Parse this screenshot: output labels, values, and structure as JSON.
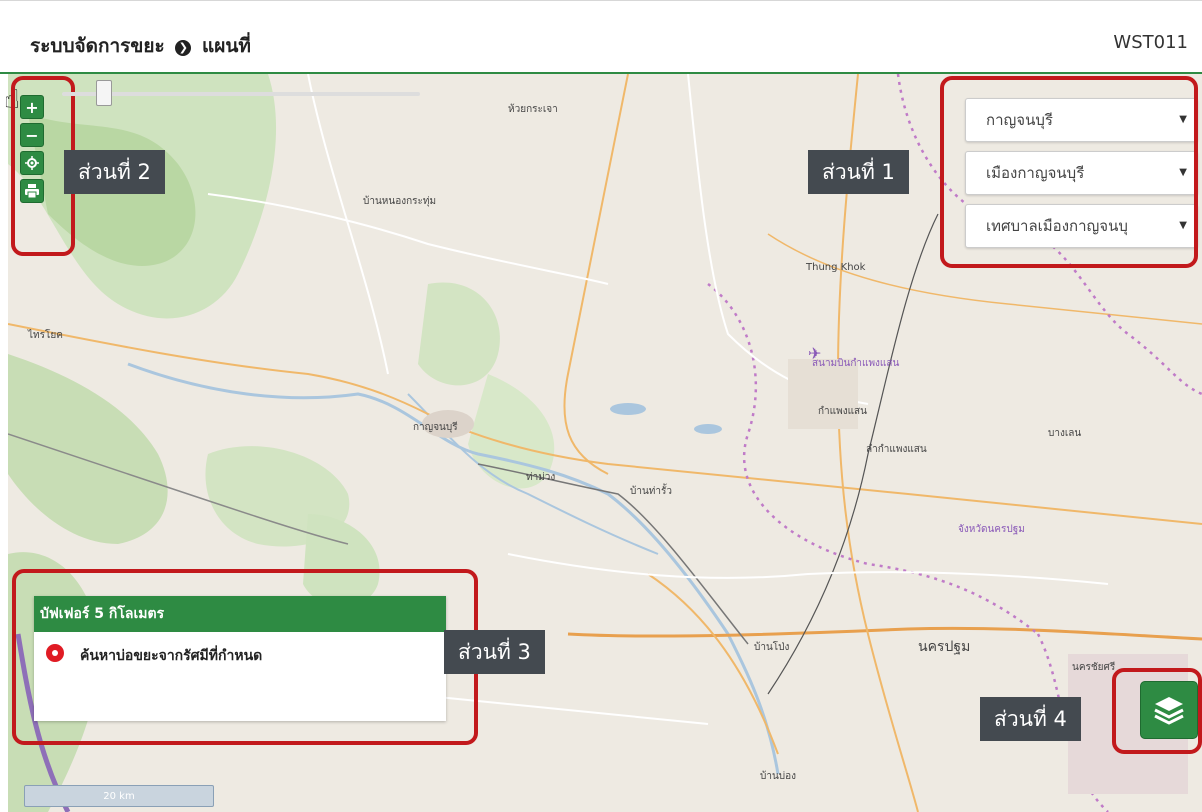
{
  "header": {
    "title": "ระบบจัดการขยะ",
    "arrow": "❯",
    "breadcrumb": "แผนที่",
    "code": "WST011"
  },
  "labels": {
    "part1": "ส่วนที่ 1",
    "part2": "ส่วนที่ 2",
    "part3": "ส่วนที่ 3",
    "part4": "ส่วนที่ 4"
  },
  "tools": {
    "zoom_in": "+",
    "zoom_out": "−",
    "locate": "⌖",
    "print": "⎙"
  },
  "selects": {
    "province": "กาญจนบุรี",
    "district": "เมืองกาญจนบุรี",
    "subdistrict": "เทศบาลเมืองกาญจนบุ"
  },
  "buffer": {
    "title": "บัฟเฟอร์ 5 กิโลเมตร",
    "option": "ค้นหาบ่อขยะจากรัศมีที่กำหนด",
    "slider_value": 0.1
  },
  "map": {
    "places": {
      "p1": "ห้วยกระเจา",
      "p2": "บ้านหนองกระทุ่ม",
      "p3": "ไทรโยค",
      "p4": "Thung Khok",
      "p5": "สนามบินกำแพงแสน",
      "p6": "กำแพงแสน",
      "p7": "ลำกำแพงแสน",
      "p8": "กาญจนบุรี",
      "p9": "ท่าม่วง",
      "p10": "บ้านท่ารั้ว",
      "p11": "จังหวัดนครปฐม",
      "p12": "นครปฐม",
      "p13": "บ้านโป่ง",
      "p14": "บ้านบ่อง",
      "p15": "นครชัยศรี",
      "p16": "บางเลน"
    },
    "scale": "20 km"
  },
  "colors": {
    "accent": "#2e8b43",
    "highlight": "#c2191c"
  }
}
